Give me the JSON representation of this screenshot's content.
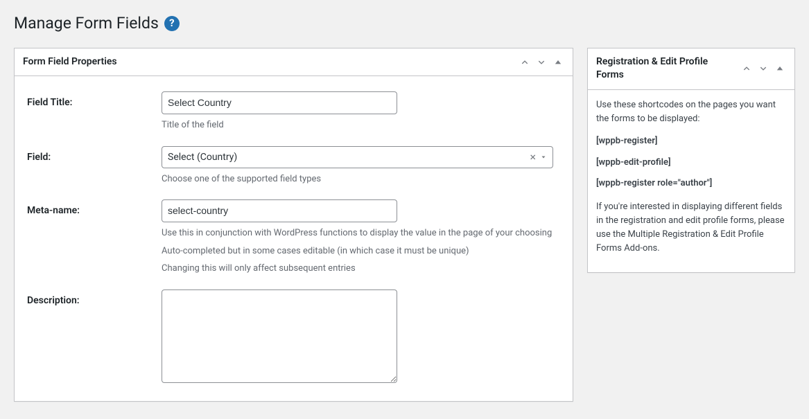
{
  "page": {
    "title": "Manage Form Fields"
  },
  "mainBox": {
    "title": "Form Field Properties",
    "fields": {
      "fieldTitle": {
        "label": "Field Title:",
        "value": "Select Country",
        "help": "Title of the field"
      },
      "field": {
        "label": "Field:",
        "value": "Select (Country)",
        "help": "Choose one of the supported field types"
      },
      "metaName": {
        "label": "Meta-name:",
        "value": "select-country",
        "help1": "Use this in conjunction with WordPress functions to display the value in the page of your choosing",
        "help2": "Auto-completed but in some cases editable (in which case it must be unique)",
        "help3": "Changing this will only affect subsequent entries"
      },
      "description": {
        "label": "Description:",
        "value": ""
      }
    }
  },
  "sideBox": {
    "title": "Registration & Edit Profile Forms",
    "intro": "Use these shortcodes on the pages you want the forms to be displayed:",
    "shortcodes": [
      "[wppb-register]",
      "[wppb-edit-profile]",
      "[wppb-register role=\"author\"]"
    ],
    "note": "If you're interested in displaying different fields in the registration and edit profile forms, please use the Multiple Registration & Edit Profile Forms Add-ons."
  }
}
